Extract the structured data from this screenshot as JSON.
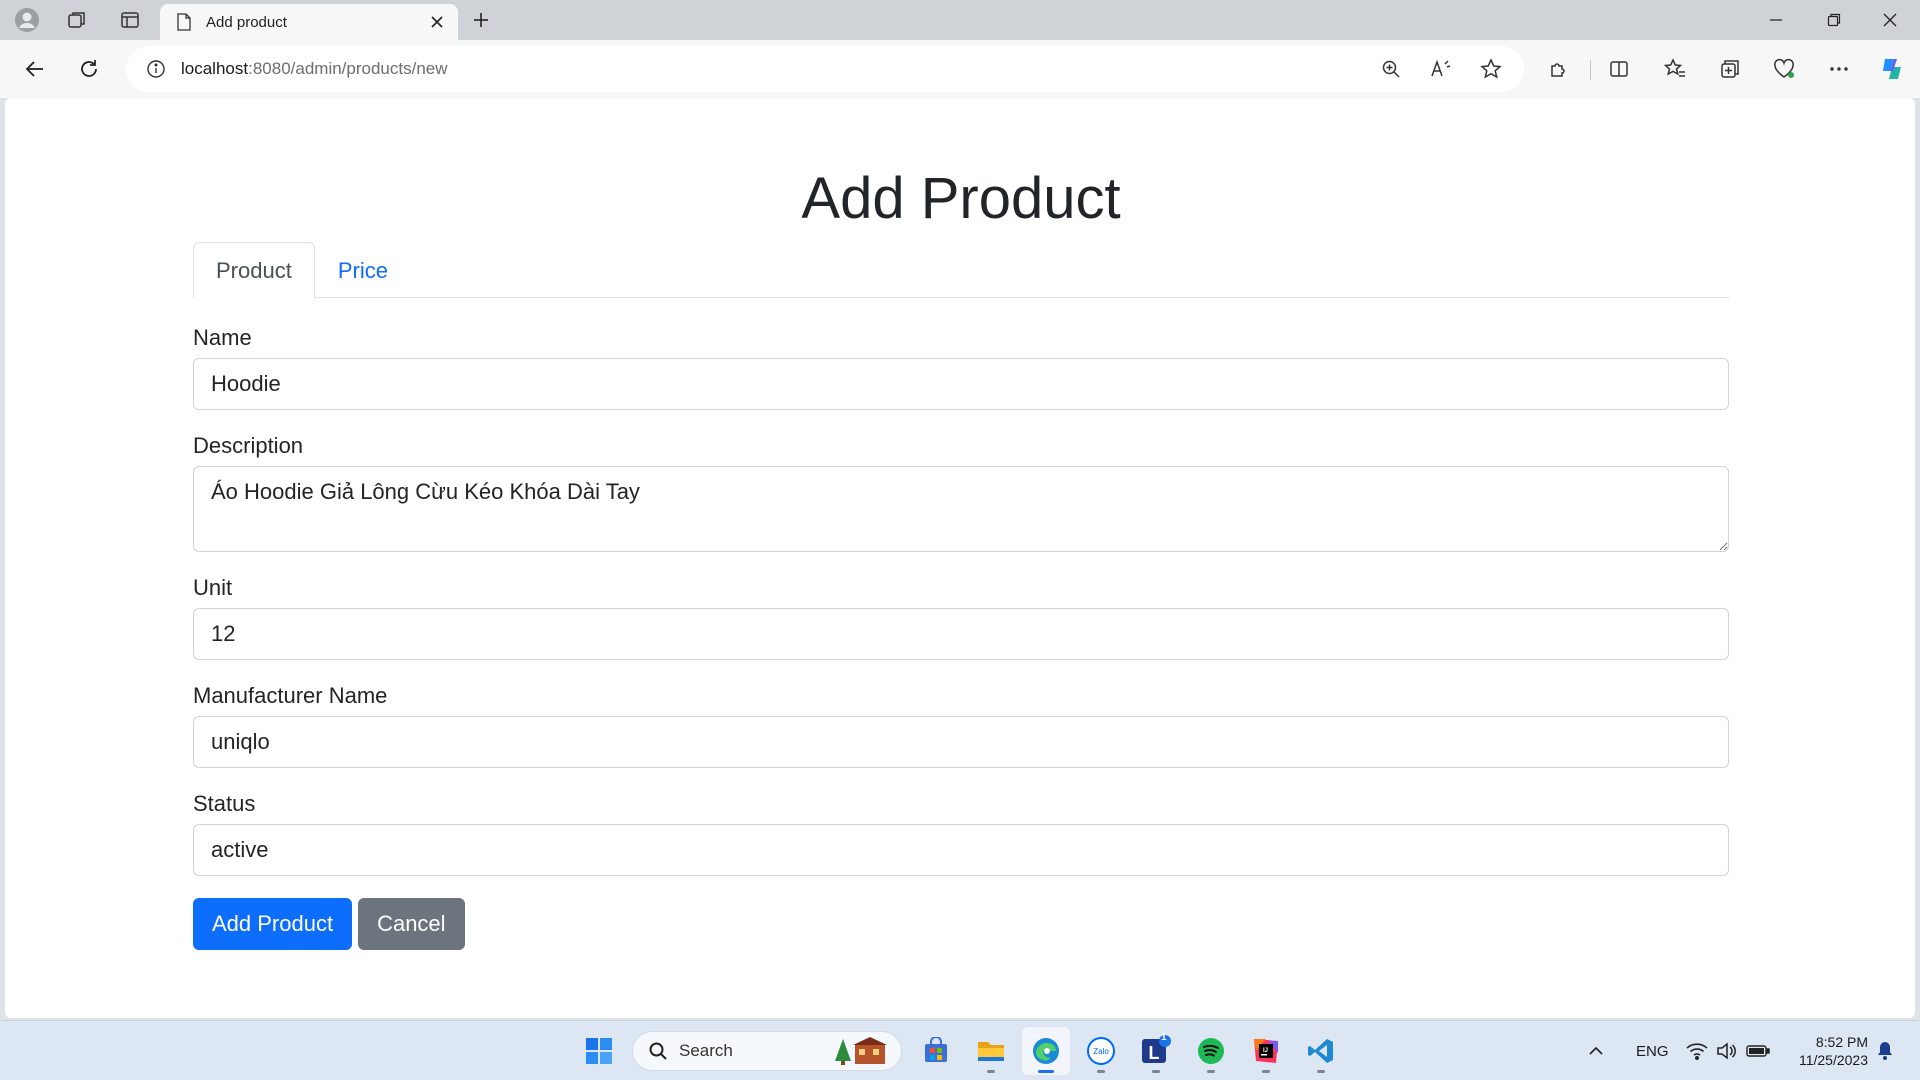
{
  "browser": {
    "tab_title": "Add product",
    "url_host": "localhost",
    "url_rest": ":8080/admin/products/new"
  },
  "page": {
    "title": "Add Product",
    "tabs": [
      {
        "label": "Product",
        "active": true
      },
      {
        "label": "Price",
        "active": false
      }
    ],
    "fields": {
      "name": {
        "label": "Name",
        "value": "Hoodie"
      },
      "description": {
        "label": "Description",
        "value": "Áo Hoodie Giả Lông Cừu Kéo Khóa Dài Tay"
      },
      "unit": {
        "label": "Unit",
        "value": "12"
      },
      "manufacturer": {
        "label": "Manufacturer Name",
        "value": "uniqlo"
      },
      "status": {
        "label": "Status",
        "value": "active"
      }
    },
    "buttons": {
      "submit": "Add Product",
      "cancel": "Cancel"
    }
  },
  "taskbar": {
    "search_placeholder": "Search",
    "language": "ENG",
    "time": "8:52 PM",
    "date": "11/25/2023",
    "notification_badge": "1"
  },
  "colors": {
    "primary": "#0d6efd",
    "secondary": "#6c757d",
    "link": "#0d6efd"
  }
}
